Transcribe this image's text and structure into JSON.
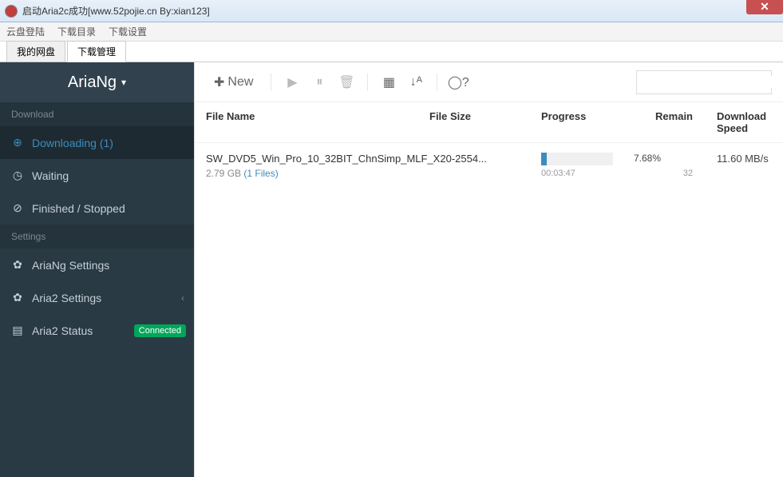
{
  "window": {
    "title": "启动Aria2c成功[www.52pojie.cn By:xian123]",
    "menus": [
      "云盘登陆",
      "下载目录",
      "下载设置"
    ],
    "tabs": [
      {
        "label": "我的网盘",
        "active": false
      },
      {
        "label": "下载管理",
        "active": true
      }
    ]
  },
  "sidebar": {
    "brand": "AriaNg",
    "sections": [
      {
        "header": "Download",
        "items": [
          {
            "icon": "download-icon",
            "label": "Downloading (1)",
            "active": true
          },
          {
            "icon": "clock-icon",
            "label": "Waiting",
            "active": false
          },
          {
            "icon": "check-icon",
            "label": "Finished / Stopped",
            "active": false
          }
        ]
      },
      {
        "header": "Settings",
        "items": [
          {
            "icon": "gear-icon",
            "label": "AriaNg Settings",
            "active": false
          },
          {
            "icon": "gear-icon",
            "label": "Aria2 Settings",
            "active": false,
            "expandable": true
          },
          {
            "icon": "server-icon",
            "label": "Aria2 Status",
            "active": false,
            "badge": "Connected"
          }
        ]
      }
    ]
  },
  "toolbar": {
    "new_label": "New",
    "search_placeholder": ""
  },
  "table": {
    "headers": {
      "name": "File Name",
      "size": "File Size",
      "progress": "Progress",
      "remain": "Remain",
      "speed": "Download Speed"
    },
    "rows": [
      {
        "filename": "SW_DVD5_Win_Pro_10_32BIT_ChnSimp_MLF_X20-2554...",
        "size": "2.79 GB",
        "files_link": "(1 Files)",
        "progress_pct": "7.68%",
        "progress_val": 7.68,
        "time_elapsed": "00:03:47",
        "remain": "32",
        "speed": "11.60 MB/s"
      }
    ]
  }
}
